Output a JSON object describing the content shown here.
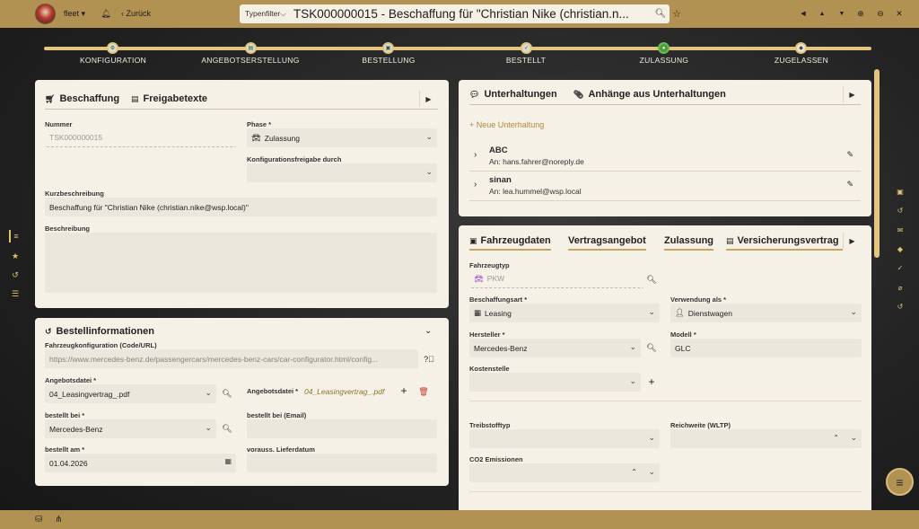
{
  "topbar": {
    "user": "fleet",
    "user_chevron": "▾",
    "back_label": "Zurück",
    "filter_label": "Typenfilter",
    "filter_chevron": "⌵",
    "search_value": "TSK000000015 - Beschaffung für \"Christian Nike (christian.n..."
  },
  "steps": [
    {
      "label": "KONFIGURATION",
      "icon": "gear-icon"
    },
    {
      "label": "ANGEBOTSERSTELLUNG",
      "icon": "document-icon"
    },
    {
      "label": "BESTELLUNG",
      "icon": "cart-icon"
    },
    {
      "label": "BESTELLT",
      "icon": "check-icon"
    },
    {
      "label": "ZULASSUNG",
      "icon": "dot-icon"
    },
    {
      "label": "ZUGELASSEN",
      "icon": "car-icon"
    }
  ],
  "beschaffung": {
    "tab1": "Beschaffung",
    "tab2": "Freigabetexte",
    "nummer_label": "Nummer",
    "nummer_value": "TSK000000015",
    "phase_label": "Phase *",
    "phase_value": "Zulassung",
    "konfig_label": "Konfigurationsfreigabe durch",
    "kurz_label": "Kurzbeschreibung",
    "kurz_value": "Beschaffung für \"Christian Nike (christian.nike@wsp.local)\"",
    "beschr_label": "Beschreibung"
  },
  "bestell": {
    "title": "Bestellinformationen",
    "fk_label": "Fahrzeugkonfiguration (Code/URL)",
    "fk_value": "https://www.mercedes-benz.de/passengercars/mercedes-benz-cars/car-configurator.html/config...",
    "angebot_label": "Angebotsdatei *",
    "angebot_value": "04_Leasingvertrag_.pdf",
    "angebot2_label": "Angebotsdatei *",
    "angebot2_value": "04_Leasingvertrag_.pdf",
    "bestellt_bei_label": "bestellt bei *",
    "bestellt_bei_value": "Mercedes-Benz",
    "email_label": "bestellt bei (Email)",
    "am_label": "bestellt am *",
    "am_value": "01.04.2026",
    "liefer_label": "vorauss. Lieferdatum"
  },
  "unterhaltungen": {
    "tab1": "Unterhaltungen",
    "tab2": "Anhänge aus Unterhaltungen",
    "new_label": "Neue Unterhaltung",
    "items": [
      {
        "title": "ABC",
        "sub": "An: hans.fahrer@noreply.de"
      },
      {
        "title": "sinan",
        "sub": "An: lea.hummel@wsp.local"
      }
    ]
  },
  "fahrzeug": {
    "tabs": [
      "Fahrzeugdaten",
      "Vertragsangebot",
      "Zulassung",
      "Versicherungsvertrag"
    ],
    "typ_label": "Fahrzeugtyp",
    "typ_value": "PKW",
    "art_label": "Beschaffungsart *",
    "art_value": "Leasing",
    "verw_label": "Verwendung als *",
    "verw_value": "Dienstwagen",
    "herst_label": "Hersteller *",
    "herst_value": "Mercedes-Benz",
    "modell_label": "Modell *",
    "modell_value": "GLC",
    "kosten_label": "Kostenstelle",
    "treib_label": "Treibstofftyp",
    "reich_label": "Reichweite (WLTP)",
    "co2_label": "CO2 Emissionen"
  },
  "colors": {
    "gold": "#b29252",
    "panel": "#f6f1e6",
    "active_step": "#4a9b3a"
  }
}
